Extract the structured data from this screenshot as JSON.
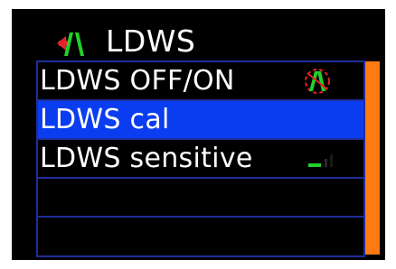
{
  "header": {
    "title": "LDWS",
    "icon": "lane-departure-icon"
  },
  "menu": {
    "items": [
      {
        "label": "LDWS OFF/ON",
        "selected": false,
        "icon": "lane-status-icon"
      },
      {
        "label": "LDWS cal",
        "selected": true
      },
      {
        "label": "LDWS sensitive",
        "selected": false,
        "indicator": "sensitivity-level-icon"
      },
      {
        "label": "",
        "selected": false
      },
      {
        "label": "",
        "selected": false
      }
    ]
  },
  "colors": {
    "background": "#000000",
    "selection": "#0a3df0",
    "row_border": "#1f2d9a",
    "scrollbar": "#ff7a12",
    "icon_green": "#22d12a",
    "icon_red": "#e8212a"
  }
}
